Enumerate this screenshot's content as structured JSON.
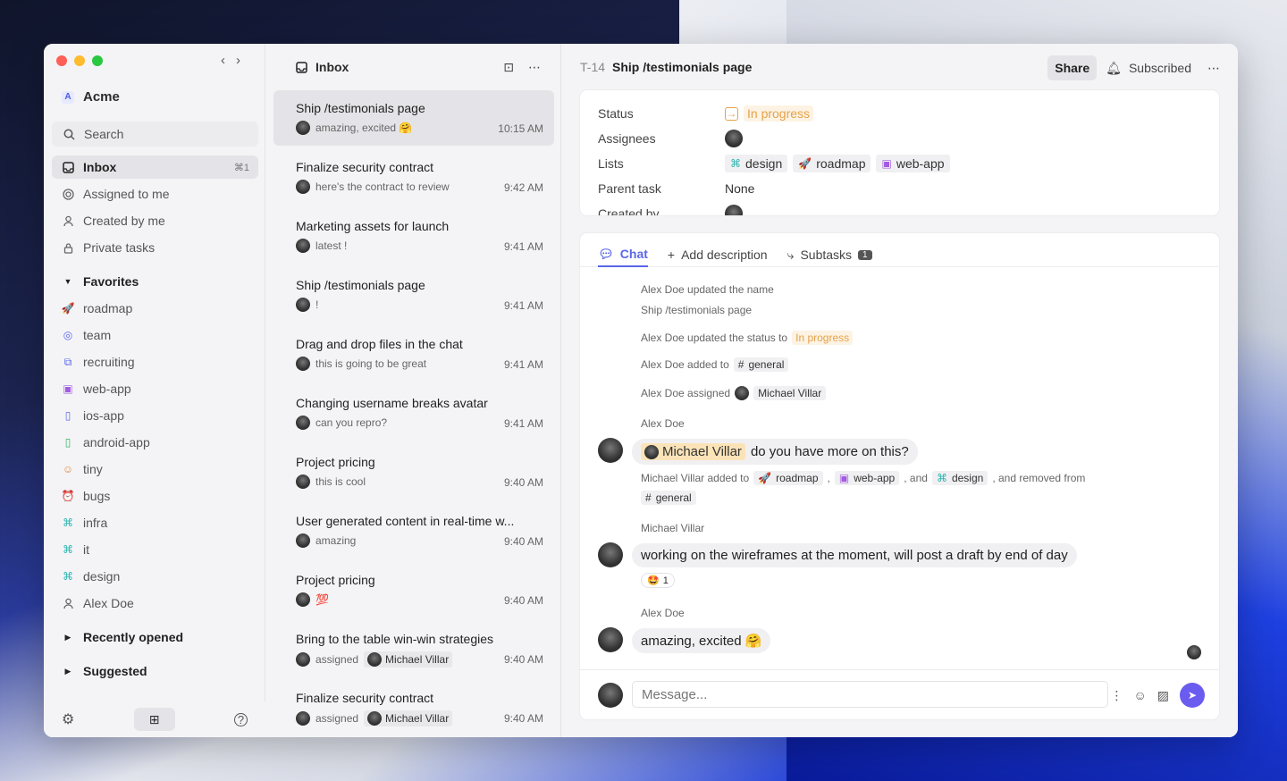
{
  "sidebar": {
    "workspace": "Acme",
    "workspace_initial": "A",
    "search": "Search",
    "nav": [
      {
        "label": "Inbox",
        "kbd": "⌘1"
      },
      {
        "label": "Assigned to me"
      },
      {
        "label": "Created by me"
      },
      {
        "label": "Private tasks"
      }
    ],
    "favorites_label": "Favorites",
    "favorites": [
      {
        "label": "roadmap"
      },
      {
        "label": "team"
      },
      {
        "label": "recruiting"
      },
      {
        "label": "web-app"
      },
      {
        "label": "ios-app"
      },
      {
        "label": "android-app"
      },
      {
        "label": "tiny"
      },
      {
        "label": "bugs"
      },
      {
        "label": "infra"
      },
      {
        "label": "it"
      },
      {
        "label": "design"
      },
      {
        "label": "Alex Doe"
      }
    ],
    "recent_label": "Recently opened",
    "suggested_label": "Suggested"
  },
  "inbox": {
    "title": "Inbox",
    "items": [
      {
        "title": "Ship /testimonials page",
        "sub": "amazing, excited 🤗",
        "time": "10:15 AM"
      },
      {
        "title": "Finalize security contract",
        "sub": "here's the contract to review",
        "time": "9:42 AM"
      },
      {
        "title": "Marketing assets for launch",
        "sub": "latest !",
        "time": "9:41 AM"
      },
      {
        "title": "Ship /testimonials page",
        "sub": "!",
        "time": "9:41 AM"
      },
      {
        "title": "Drag and drop files in the chat",
        "sub": "this is going to be great",
        "time": "9:41 AM"
      },
      {
        "title": "Changing username breaks avatar",
        "sub": "can you repro?",
        "time": "9:41 AM"
      },
      {
        "title": "Project pricing",
        "sub": "this is cool",
        "time": "9:40 AM"
      },
      {
        "title": "User generated content in real-time w...",
        "sub": "amazing",
        "time": "9:40 AM"
      },
      {
        "title": "Project pricing",
        "sub": "💯",
        "time": "9:40 AM"
      },
      {
        "title": "Bring to the table win-win strategies",
        "sub": "assigned",
        "mention": "Michael Villar",
        "time": "9:40 AM"
      },
      {
        "title": "Finalize security contract",
        "sub": "assigned",
        "mention": "Michael Villar",
        "time": "9:40 AM"
      }
    ]
  },
  "detail": {
    "id": "T-14",
    "title": "Ship /testimonials page",
    "share": "Share",
    "subscribed": "Subscribed",
    "props": {
      "status_label": "Status",
      "status": "In progress",
      "assignees_label": "Assignees",
      "lists_label": "Lists",
      "lists": [
        "design",
        "roadmap",
        "web-app"
      ],
      "parent_label": "Parent task",
      "parent": "None",
      "created_label": "Created by"
    },
    "tabs": {
      "chat": "Chat",
      "add_desc": "Add description",
      "subtasks": "Subtasks",
      "subtasks_count": "1"
    },
    "events": {
      "e1": "Alex Doe updated the name",
      "e1b": "Ship /testimonials page",
      "e2": "Alex Doe updated the status to",
      "e2_status": "In progress",
      "e3": "Alex Doe added to",
      "e3_tag": "general",
      "e4": "Alex Doe assigned",
      "e4_user": "Michael Villar",
      "a1": "Alex Doe",
      "m1_mention": "Michael Villar",
      "m1": "do you have more on this?",
      "e5": "Michael Villar added to",
      "e5_t1": "roadmap",
      "e5_t2": "web-app",
      "e5_and": ", and",
      "e5_t3": "design",
      "e5_rem": ", and removed from",
      "e5_t4": "general",
      "comma": ",",
      "a2": "Michael Villar",
      "m2": "working on the wireframes at the moment, will post a draft by end of day",
      "r2": "1",
      "a3": "Alex Doe",
      "m3": "amazing, excited 🤗"
    },
    "composer_placeholder": "Message..."
  }
}
